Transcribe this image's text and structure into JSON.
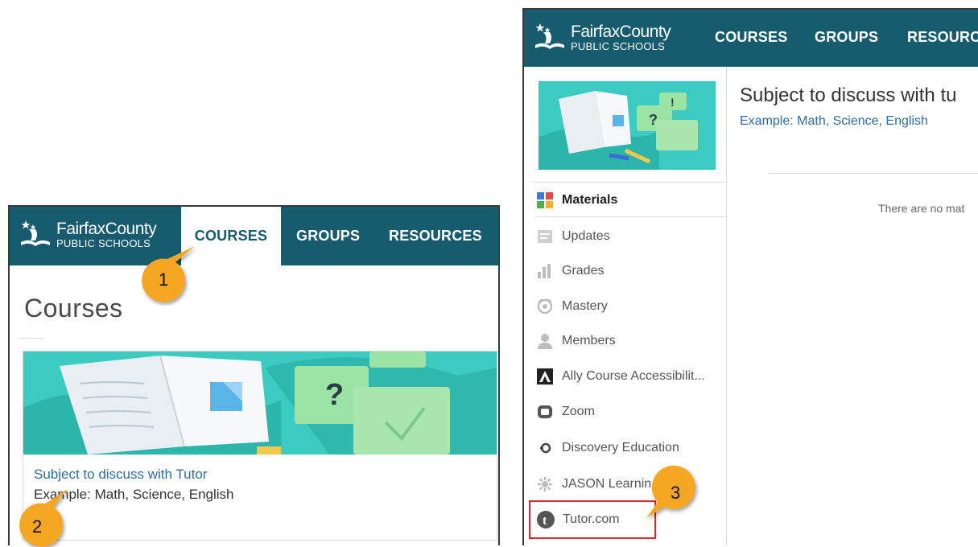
{
  "brand": {
    "name_line1": "FairfaxCounty",
    "name_line2": "PUBLIC SCHOOLS"
  },
  "nav": {
    "courses": "COURSES",
    "groups": "GROUPS",
    "resources": "RESOURCES",
    "resources_truncated": "RESOURC"
  },
  "courses_page": {
    "title": "Courses",
    "card": {
      "name": "Subject to discuss with Tutor",
      "subtitle": "Example: Math, Science, English"
    }
  },
  "course_page": {
    "title": "Subject to discuss with tu",
    "subtitle": "Example: Math, Science, English",
    "empty_message": "There are no mat"
  },
  "sidebar": {
    "items": [
      {
        "label": "Materials",
        "icon": "materials-icon"
      },
      {
        "label": "Updates",
        "icon": "updates-icon"
      },
      {
        "label": "Grades",
        "icon": "grades-icon"
      },
      {
        "label": "Mastery",
        "icon": "mastery-icon"
      },
      {
        "label": "Members",
        "icon": "members-icon"
      },
      {
        "label": "Ally Course Accessibilit...",
        "icon": "ally-icon"
      },
      {
        "label": "Zoom",
        "icon": "zoom-icon"
      },
      {
        "label": "Discovery Education",
        "icon": "discovery-icon"
      },
      {
        "label": "JASON Learnin",
        "icon": "jason-icon"
      },
      {
        "label": "Tutor.com",
        "icon": "tutor-icon"
      }
    ]
  },
  "callouts": {
    "step1": "1",
    "step2": "2",
    "step3": "3"
  },
  "colors": {
    "header_teal": "#175b6e",
    "link_blue": "#2e6da4",
    "callout_orange": "#f5a623",
    "highlight_red": "#e0242c",
    "banner_teal": "#3ccbc0"
  }
}
